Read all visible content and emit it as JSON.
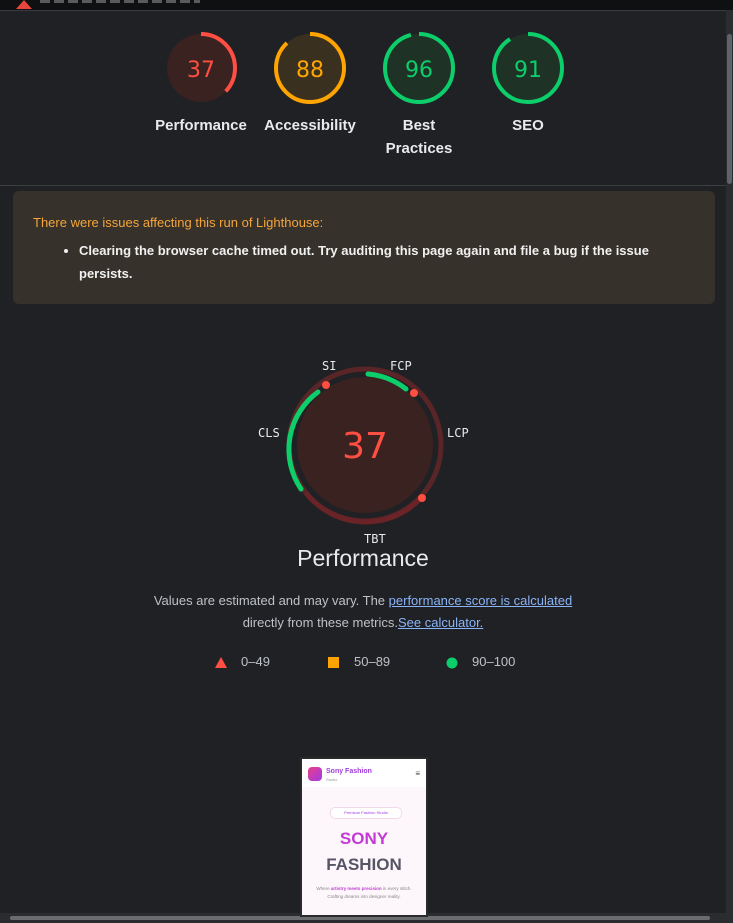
{
  "gauges": [
    {
      "value": "37",
      "score": 37,
      "label": "Performance",
      "color": "#ff4e42",
      "fill": "#3a2220"
    },
    {
      "value": "88",
      "score": 88,
      "label": "Accessibility",
      "color": "#ffa400",
      "fill": "#3a3020"
    },
    {
      "value": "96",
      "score": 96,
      "label": "Best Practices",
      "color": "#0cce6b",
      "fill": "#1e3325"
    },
    {
      "value": "91",
      "score": 91,
      "label": "SEO",
      "color": "#0cce6b",
      "fill": "#1e3325"
    }
  ],
  "warning": {
    "title": "There were issues affecting this run of Lighthouse:",
    "item": "Clearing the browser cache timed out. Try auditing this page again and file a bug if the issue persists."
  },
  "performance": {
    "score": "37",
    "title": "Performance",
    "metrics": {
      "si": "SI",
      "fcp": "FCP",
      "cls": "CLS",
      "lcp": "LCP",
      "tbt": "TBT"
    },
    "note_pre": "Values are estimated and may vary. The ",
    "note_link": "performance score is calculated",
    "note_mid": "directly from these metrics.",
    "note_calc": "See calculator."
  },
  "legend": [
    {
      "range": "0–49",
      "color": "#ff4e42",
      "shape": "triangle"
    },
    {
      "range": "50–89",
      "color": "#ffa400",
      "shape": "square"
    },
    {
      "range": "90–100",
      "color": "#0cce6b",
      "shape": "circle"
    }
  ],
  "screenshot": {
    "brand": "Sony Fashion",
    "sub": "Studio",
    "badge": "Premium Fashion Studio",
    "heading1": "SONY",
    "heading2": "FASHION",
    "text_pre": "Where ",
    "text_em": "artistry meets precision",
    "text_post": " in every stitch. Crafting dreams into designer reality."
  }
}
